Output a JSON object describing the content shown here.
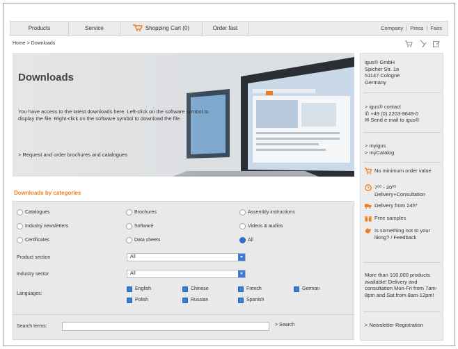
{
  "nav": {
    "tabs": [
      "Products",
      "Service",
      "Shopping Cart (0)",
      "Order fast"
    ],
    "right_links": [
      "Company",
      "Press",
      "Fairs"
    ]
  },
  "breadcrumb": "Home > Downloads",
  "hero": {
    "title": "Downloads",
    "text": "You have access to the latest downloads here. Left-click on the software symbol to display the file. Right-click on the software symbol to download the file.",
    "link": "> Request and order brochures and catalogues"
  },
  "categories": {
    "title": "Downloads by categories",
    "radios": [
      {
        "label": "Catalogues",
        "checked": false
      },
      {
        "label": "Brochures",
        "checked": false
      },
      {
        "label": "Assembly instructions",
        "checked": false
      },
      {
        "label": "Industry newsletters",
        "checked": false
      },
      {
        "label": "Software",
        "checked": false
      },
      {
        "label": "Videos & audios",
        "checked": false
      },
      {
        "label": "Certificates",
        "checked": false
      },
      {
        "label": "Data sheets",
        "checked": false
      },
      {
        "label": "All",
        "checked": true
      }
    ],
    "product_section": {
      "label": "Product section",
      "value": "All"
    },
    "industry_sector": {
      "label": "Industry sector",
      "value": "All"
    },
    "languages_label": "Languages:",
    "languages": [
      "English",
      "Chinese",
      "French",
      "German",
      "Polish",
      "Russian",
      "Spanish"
    ],
    "search_label": "Search terms:",
    "search_value": "",
    "search_button": "> Search"
  },
  "aside": {
    "address": [
      "igus® GmbH",
      "Spicher Str. 1a",
      "51147 Cologne",
      "Germany"
    ],
    "contact": [
      "> igus® contact",
      "+49 (0) 2203-9649-0",
      "Send e-mail to igus®"
    ],
    "links": [
      "> myigus",
      "> myCatalog"
    ],
    "perks": [
      "No minimum order value",
      "7⁰⁰ - 20⁰⁰ Delivery+Consultation",
      "Delivery from 24h*",
      "Free samples",
      "Is something not to your liking? / Feedback"
    ],
    "promo": "More than 100,000 products available! Delivery and consultation Mon-Fri from 7am-8pm and Sat from 8am-12pm!",
    "newsletter": "> Newsletter Registration"
  },
  "colors": {
    "accent": "#ee7d1e",
    "blue": "#3b7bd6"
  }
}
